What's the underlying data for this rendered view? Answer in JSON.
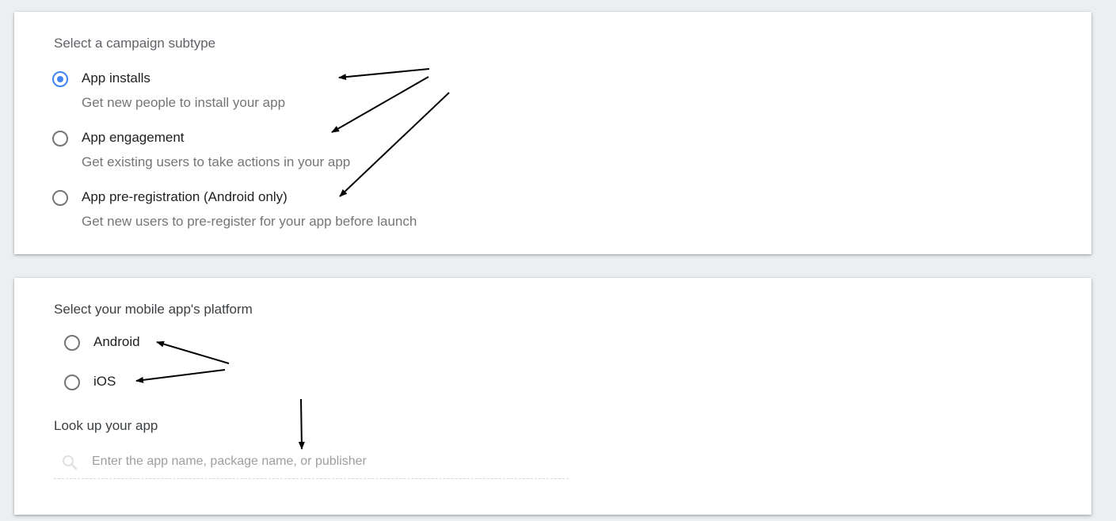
{
  "campaign_subtype": {
    "title": "Select a campaign subtype",
    "options": [
      {
        "label": "App installs",
        "description": "Get new people to install your app",
        "selected": true
      },
      {
        "label": "App engagement",
        "description": "Get existing users to take actions in your app",
        "selected": false
      },
      {
        "label": "App pre-registration (Android only)",
        "description": "Get new users to pre-register for your app before launch",
        "selected": false
      }
    ]
  },
  "platform": {
    "title": "Select your mobile app's platform",
    "options": [
      {
        "label": "Android",
        "selected": false
      },
      {
        "label": "iOS",
        "selected": false
      }
    ]
  },
  "lookup": {
    "title": "Look up your app",
    "placeholder": "Enter the app name, package name, or publisher",
    "value": ""
  },
  "colors": {
    "accent": "#4285f4",
    "background": "#eceff1",
    "card": "#ffffff",
    "annotation_arrow": "#000000"
  },
  "icons": {
    "search": "search-icon"
  }
}
